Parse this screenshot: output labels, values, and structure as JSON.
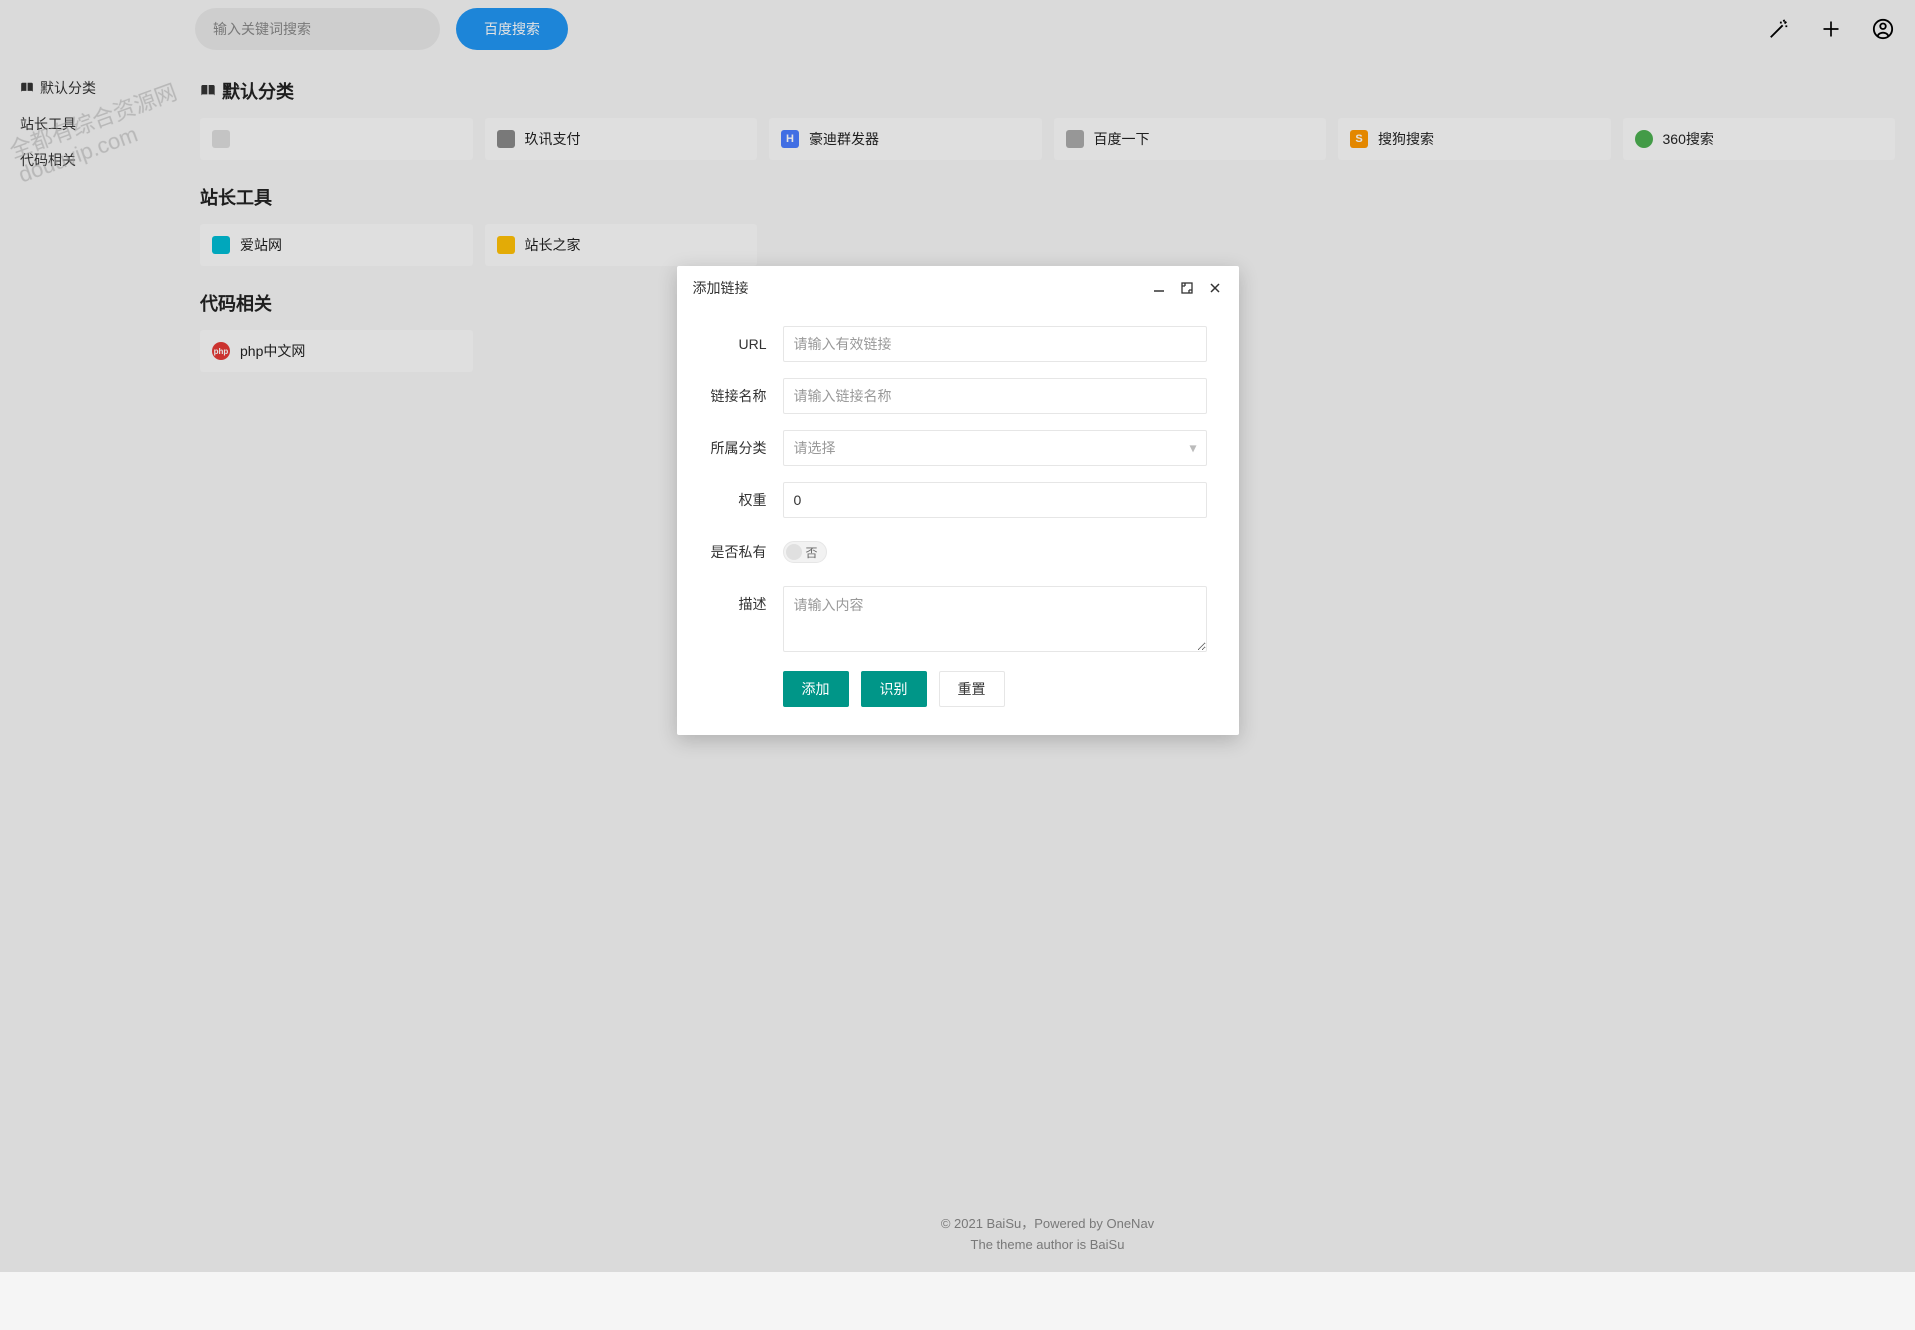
{
  "watermark": {
    "line1": "全都有综合资源网",
    "line2": "douuvip.com"
  },
  "header": {
    "search_placeholder": "输入关键词搜索",
    "search_button": "百度搜索"
  },
  "sidebar": {
    "items": [
      {
        "label": "默认分类",
        "icon": "book"
      },
      {
        "label": "站长工具"
      },
      {
        "label": "代码相关"
      }
    ]
  },
  "sections": [
    {
      "title": "默认分类",
      "icon": "book",
      "cards": [
        {
          "label": "",
          "icon_color": "#ddd"
        },
        {
          "label": "玖讯支付",
          "icon_color": "#888"
        },
        {
          "label": "豪迪群发器",
          "icon_color": "#4a7cff"
        },
        {
          "label": "百度一下",
          "icon_color": "#aaa"
        },
        {
          "label": "搜狗搜索",
          "icon_color": "#ff9800"
        },
        {
          "label": "360搜索",
          "icon_color": "#4caf50"
        }
      ]
    },
    {
      "title": "站长工具",
      "cards": [
        {
          "label": "爱站网",
          "icon_color": "#00bcd4"
        },
        {
          "label": "站长之家",
          "icon_color": "#ffc107"
        }
      ]
    },
    {
      "title": "代码相关",
      "cards": [
        {
          "label": "php中文网",
          "icon_color": "#e53935"
        }
      ]
    }
  ],
  "footer": {
    "line1": "© 2021 BaiSu，Powered by OneNav",
    "line2": "The theme author is BaiSu"
  },
  "modal": {
    "title": "添加链接",
    "fields": {
      "url_label": "URL",
      "url_placeholder": "请输入有效链接",
      "name_label": "链接名称",
      "name_placeholder": "请输入链接名称",
      "category_label": "所属分类",
      "category_placeholder": "请选择",
      "weight_label": "权重",
      "weight_value": "0",
      "private_label": "是否私有",
      "private_off": "否",
      "desc_label": "描述",
      "desc_placeholder": "请输入内容"
    },
    "actions": {
      "add": "添加",
      "recognize": "识别",
      "reset": "重置"
    }
  }
}
